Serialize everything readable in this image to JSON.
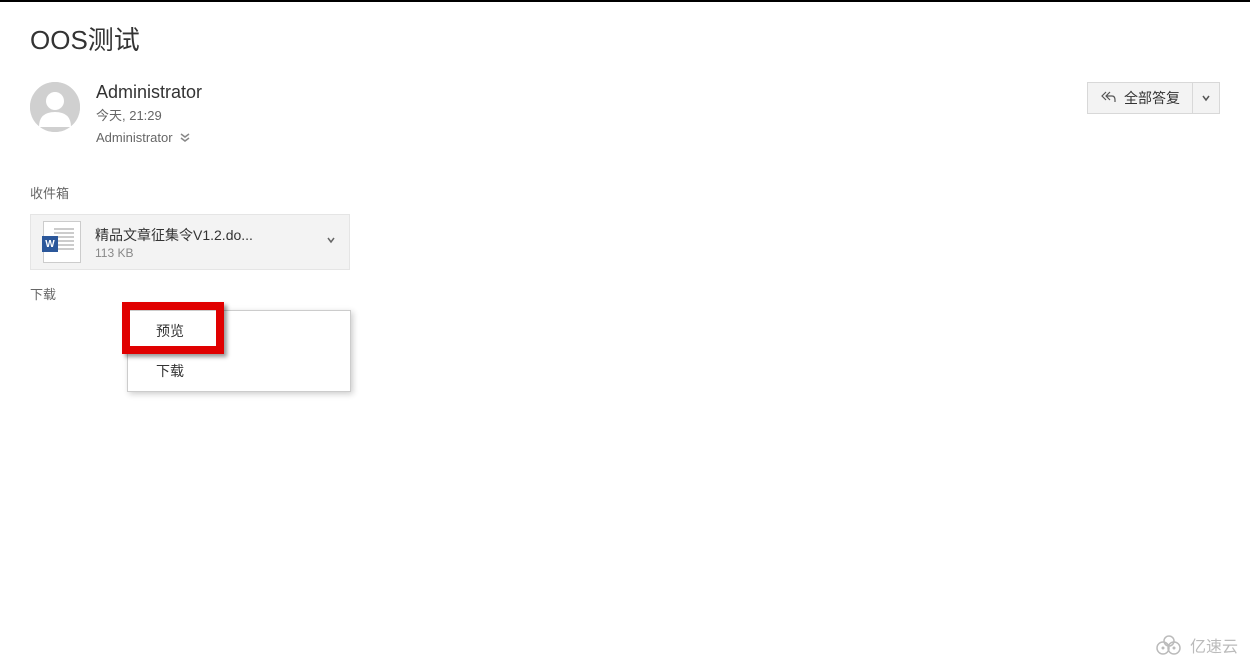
{
  "subject": "OOS测试",
  "sender": {
    "name": "Administrator",
    "timestamp": "今天, 21:29",
    "recipient": "Administrator"
  },
  "actions": {
    "reply_all": "全部答复"
  },
  "folder_label": "收件箱",
  "attachment": {
    "filename": "精品文章征集令V1.2.do...",
    "size": "113 KB",
    "badge": "W"
  },
  "download_all": "下载",
  "menu": {
    "preview": "预览",
    "download": "下载"
  },
  "watermark": "亿速云"
}
